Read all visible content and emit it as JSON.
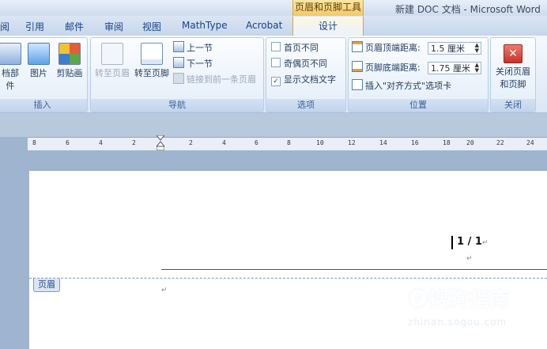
{
  "titlebar": {
    "context_group": "页眉和页脚工具",
    "doc_title": "新建 DOC 文档 - Microsoft Word"
  },
  "tabs": [
    {
      "label": "阅"
    },
    {
      "label": "引用"
    },
    {
      "label": "邮件"
    },
    {
      "label": "审阅"
    },
    {
      "label": "视图"
    },
    {
      "label": "MathType"
    },
    {
      "label": "Acrobat"
    },
    {
      "label": "设计"
    }
  ],
  "ribbon": {
    "insert": {
      "label": "插入",
      "parts_label": "档部件",
      "picture_label": "图片",
      "clipart_label": "剪贴画"
    },
    "nav": {
      "label": "导航",
      "goto_header": "转至页眉",
      "goto_footer": "转至页脚",
      "prev": "上一节",
      "next": "下一节",
      "link_prev": "链接到前一条页眉"
    },
    "options": {
      "label": "选项",
      "diff_first": "首页不同",
      "diff_oddeven": "奇偶页不同",
      "show_text": "显示文档文字",
      "show_text_checked": "✓"
    },
    "position": {
      "label": "位置",
      "header_dist_label": "页眉顶端距离:",
      "header_dist_value": "1.5 厘米",
      "footer_dist_label": "页脚底端距离:",
      "footer_dist_value": "1.75 厘米",
      "insert_align": "插入\"对齐方式\"选项卡"
    },
    "close": {
      "label": "关闭",
      "close_btn_line1": "关闭页眉",
      "close_btn_line2": "和页脚"
    }
  },
  "ruler": {
    "numbers": [
      "8",
      "6",
      "4",
      "2",
      "2",
      "4",
      "6",
      "8",
      "10",
      "12",
      "14",
      "16",
      "18",
      "20",
      "22",
      "24"
    ]
  },
  "document": {
    "page_number": "1 / 1",
    "header_tag": "页眉",
    "paragraph_mark": "↵"
  },
  "watermark": {
    "logo_text": "ⓢ搜狗指南",
    "url": "zhinan.sogou.com"
  },
  "colors": {
    "context_tab": "#f2c966",
    "ribbon_text": "#15428b",
    "close_button": "#d9453c"
  }
}
